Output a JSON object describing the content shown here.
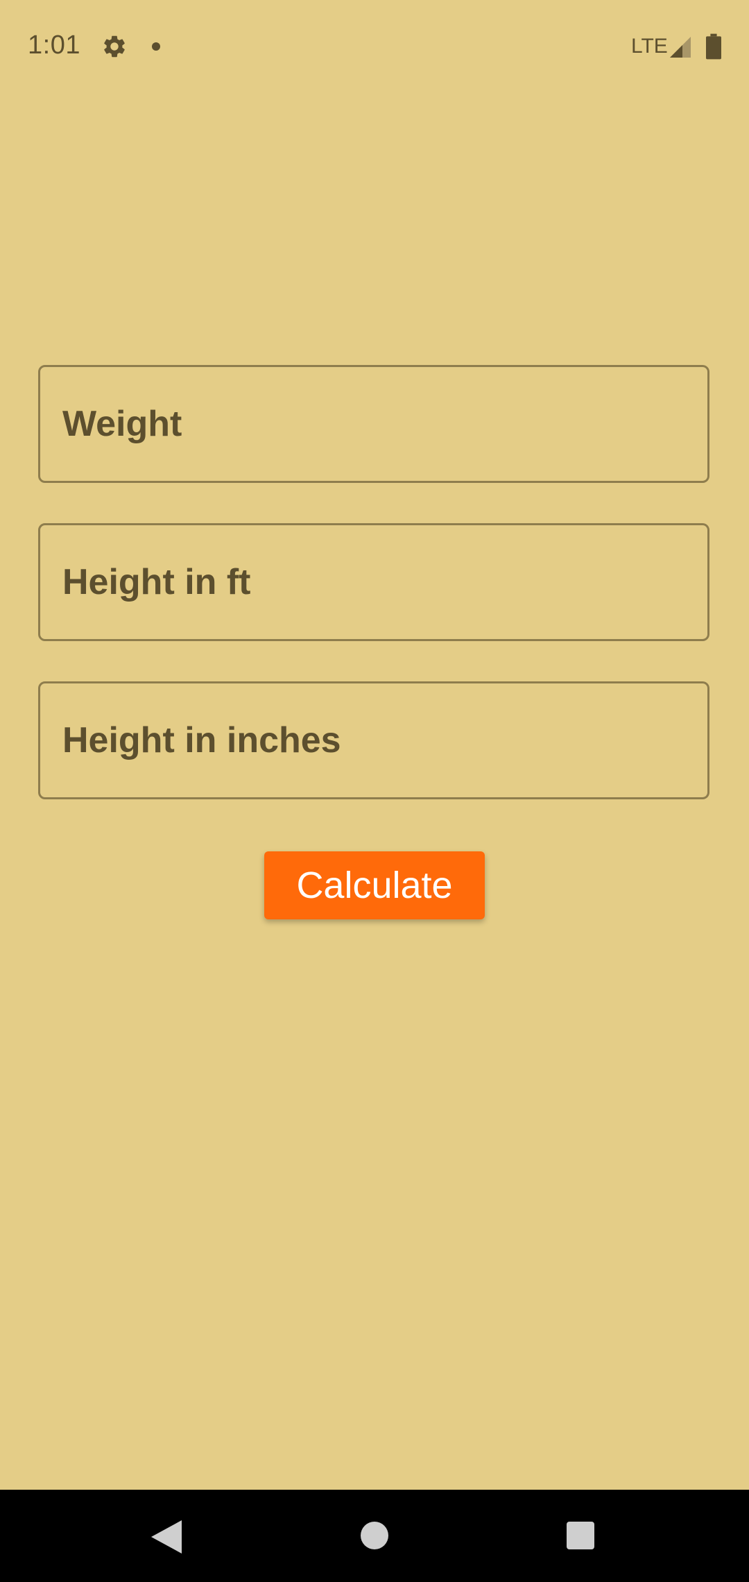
{
  "status_bar": {
    "time": "1:01",
    "network": "LTE",
    "icons": [
      "settings-icon",
      "notification-dot",
      "signal-icon",
      "battery-icon"
    ]
  },
  "form": {
    "weight_placeholder": "Weight",
    "height_ft_placeholder": "Height in ft",
    "height_inches_placeholder": "Height in inches",
    "weight_value": "",
    "height_ft_value": "",
    "height_inches_value": ""
  },
  "calculate_label": "Calculate",
  "nav_bar": {
    "icons": [
      "back-icon",
      "home-icon",
      "recents-icon"
    ]
  },
  "colors": {
    "background": "#E4CD87",
    "text": "#5C4F2E",
    "field_border": "#8E7D4D",
    "accent": "#FF6A0A",
    "nav_bar": "#000000"
  }
}
